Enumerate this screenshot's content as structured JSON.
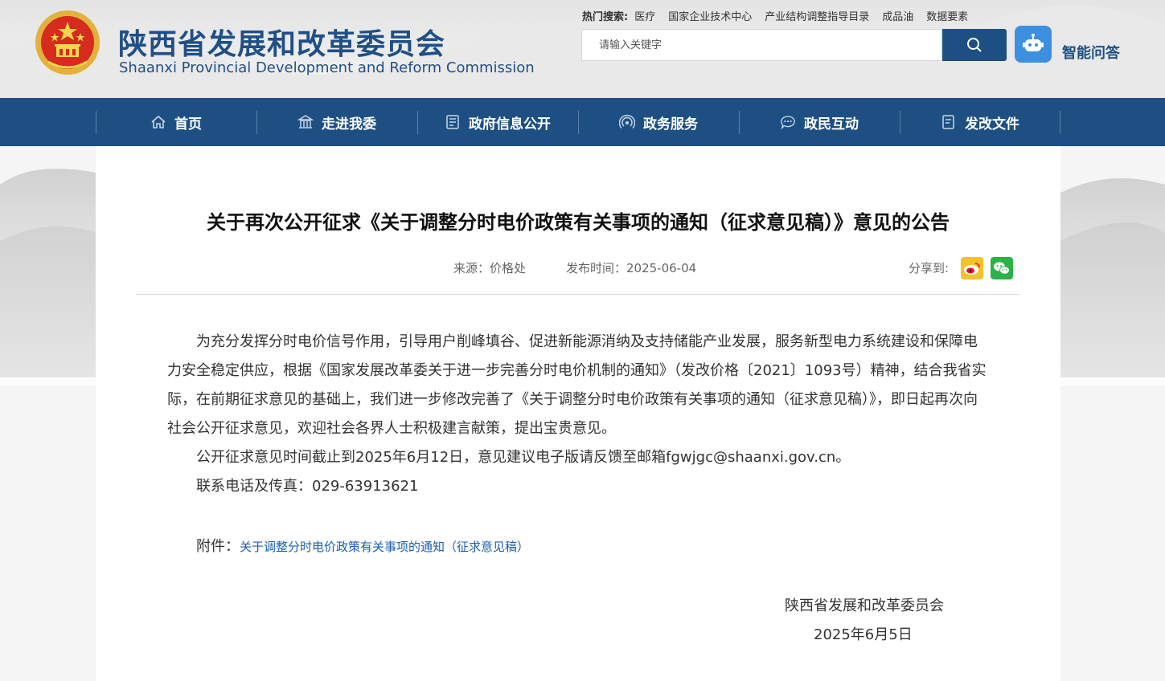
{
  "header": {
    "title_cn": "陕西省发展和改革委员会",
    "title_en": "Shaanxi Provincial Development and Reform Commission",
    "hot_search_label": "热门搜索:",
    "hot_search_items": [
      "医疗",
      "国家企业技术中心",
      "产业结构调整指导目录",
      "成品油",
      "数据要素"
    ],
    "search_placeholder": "请输入关键字",
    "qa_label": "智能问答"
  },
  "nav": {
    "items": [
      {
        "label": "首页",
        "icon": "home-icon"
      },
      {
        "label": "走进我委",
        "icon": "building-icon"
      },
      {
        "label": "政府信息公开",
        "icon": "document-icon"
      },
      {
        "label": "政务服务",
        "icon": "signal-icon"
      },
      {
        "label": "政民互动",
        "icon": "chat-icon"
      },
      {
        "label": "发改文件",
        "icon": "file-icon"
      }
    ]
  },
  "article": {
    "title": "关于再次公开征求《关于调整分时电价政策有关事项的通知（征求意见稿）》意见的公告",
    "source": "来源：价格处",
    "publish_time": "发布时间：2025-06-04",
    "share_label": "分享到:",
    "paragraphs": [
      "为充分发挥分时电价信号作用，引导用户削峰填谷、促进新能源消纳及支持储能产业发展，服务新型电力系统建设和保障电力安全稳定供应，根据《国家发展改革委关于进一步完善分时电价机制的通知》（发改价格〔2021〕1093号）精神，结合我省实际，在前期征求意见的基础上，我们进一步修改完善了《关于调整分时电价政策有关事项的通知（征求意见稿）》，即日起再次向社会公开征求意见，欢迎社会各界人士积极建言献策，提出宝贵意见。",
      "公开征求意见时间截止到2025年6月12日，意见建议电子版请反馈至邮箱fgwjgc@shaanxi.gov.cn。",
      "联系电话及传真：029-63913621"
    ],
    "attachment_label": "附件：",
    "attachment_link": "关于调整分时电价政策有关事项的通知（征求意见稿）",
    "sign_org": "陕西省发展和改革委员会",
    "sign_date": "2025年6月5日"
  },
  "colors": {
    "brand_blue": "#1d4f83",
    "link_blue": "#1a5fb4",
    "weibo": "#f5c22c",
    "wechat": "#2bb34a"
  }
}
